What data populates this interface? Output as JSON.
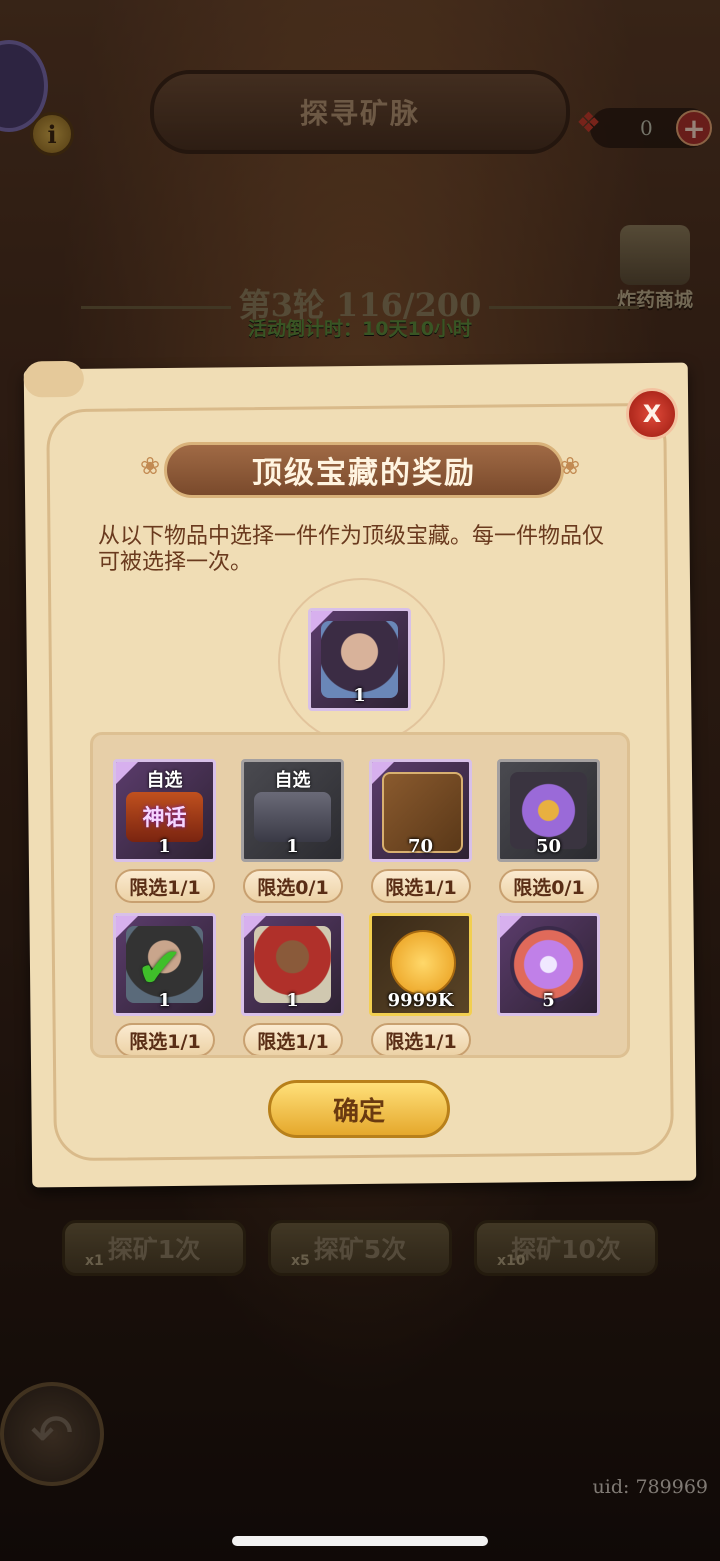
{
  "header": {
    "title": "探寻矿脉",
    "info_icon": "i",
    "dynamite_count": "0"
  },
  "shop": {
    "label": "炸药商城"
  },
  "round": {
    "text": "第3轮 116/200",
    "countdown": "活动倒计时：10天10小时"
  },
  "dialog": {
    "title": "顶级宝藏的奖励",
    "close_label": "X",
    "description": "从以下物品中选择一件作为顶级宝藏。每一件物品仅可被选择一次。",
    "featured": {
      "count": "1",
      "icon": "hero-portrait"
    },
    "items": [
      {
        "badge": "自选",
        "sublabel": "神话",
        "count": "1",
        "limit": "限选1/1",
        "icon": "mythic-chest",
        "frame": "purple"
      },
      {
        "badge": "自选",
        "count": "1",
        "limit": "限选0/1",
        "icon": "iron-chest",
        "frame": "gray"
      },
      {
        "count": "70",
        "limit": "限选1/1",
        "icon": "card-pack",
        "frame": "purple"
      },
      {
        "count": "50",
        "limit": "限选0/1",
        "icon": "crystal-shard",
        "frame": "gray"
      },
      {
        "count": "1",
        "limit": "限选1/1",
        "icon": "hero-portrait",
        "frame": "purple",
        "selected": true
      },
      {
        "count": "1",
        "limit": "限选1/1",
        "icon": "warrior-hero",
        "frame": "purple"
      },
      {
        "count": "9999K",
        "limit": "限选1/1",
        "icon": "gold-coin",
        "frame": "gold"
      },
      {
        "count": "5",
        "limit": "",
        "icon": "magic-orb",
        "frame": "purple"
      }
    ],
    "confirm_label": "确定"
  },
  "explore": {
    "buttons": [
      {
        "label": "探矿1次",
        "mult": "x1"
      },
      {
        "label": "探矿5次",
        "mult": "x5"
      },
      {
        "label": "探矿10次",
        "mult": "x10"
      }
    ]
  },
  "footer": {
    "uid": "uid: 789969"
  },
  "colors": {
    "parchment": "#f0ddb5",
    "title_bar": "#8a5434",
    "confirm_gold": "#f2c24a",
    "close_red": "#c0302a"
  }
}
